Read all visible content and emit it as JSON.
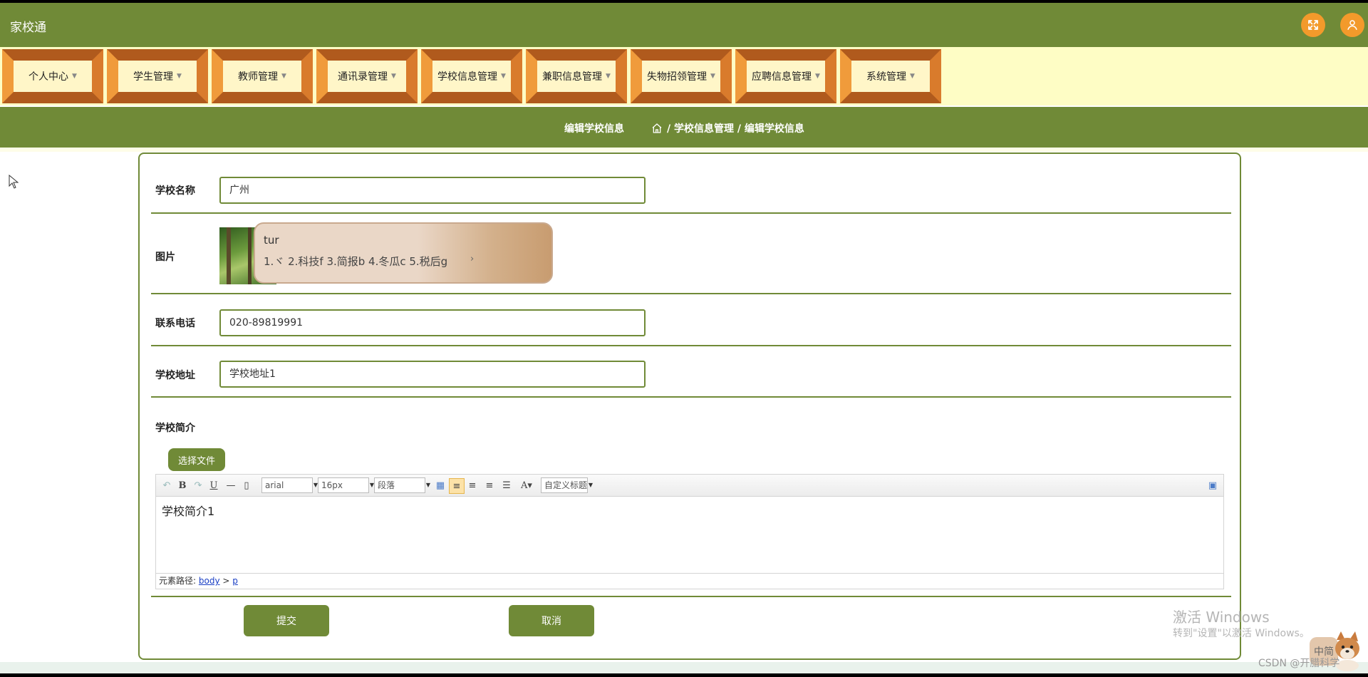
{
  "header": {
    "title": "家校通",
    "fullscreen_icon": "expand-icon",
    "user_icon": "user-icon"
  },
  "nav": {
    "items": [
      {
        "label": "个人中心"
      },
      {
        "label": "学生管理"
      },
      {
        "label": "教师管理"
      },
      {
        "label": "通讯录管理"
      },
      {
        "label": "学校信息管理"
      },
      {
        "label": "兼职信息管理"
      },
      {
        "label": "失物招领管理"
      },
      {
        "label": "应聘信息管理"
      },
      {
        "label": "系统管理"
      }
    ]
  },
  "breadcrumb": {
    "title": "编辑学校信息",
    "path": "/ 学校信息管理 / 编辑学校信息"
  },
  "form": {
    "name_label": "学校名称",
    "name_value": "广州",
    "image_label": "图片",
    "phone_label": "联系电话",
    "phone_value": "020-89819991",
    "address_label": "学校地址",
    "address_value": "学校地址1",
    "intro_label": "学校简介",
    "choose_file": "选择文件"
  },
  "ime": {
    "typed": "tur",
    "candidates": "1.ヾ  2.科技f  3.简报b  4.冬瓜c  5.税后g"
  },
  "editor": {
    "font_family": "arial",
    "font_size": "16px",
    "paragraph": "段落",
    "custom_title": "自定义标题",
    "content": "学校简介1",
    "status_prefix": "元素路径:",
    "status_body": "body",
    "status_sep": " > ",
    "status_p": "p"
  },
  "actions": {
    "submit": "提交",
    "cancel": "取消"
  },
  "watermark": {
    "line1": "激活 Windows",
    "line2": "转到\"设置\"以激活 Windows。",
    "csdn": "CSDN @开腊科学",
    "ime_mode": "中简"
  },
  "colors": {
    "primary": "#708a37",
    "accent": "#f39a2b",
    "nav_bg": "#fefdc5"
  }
}
